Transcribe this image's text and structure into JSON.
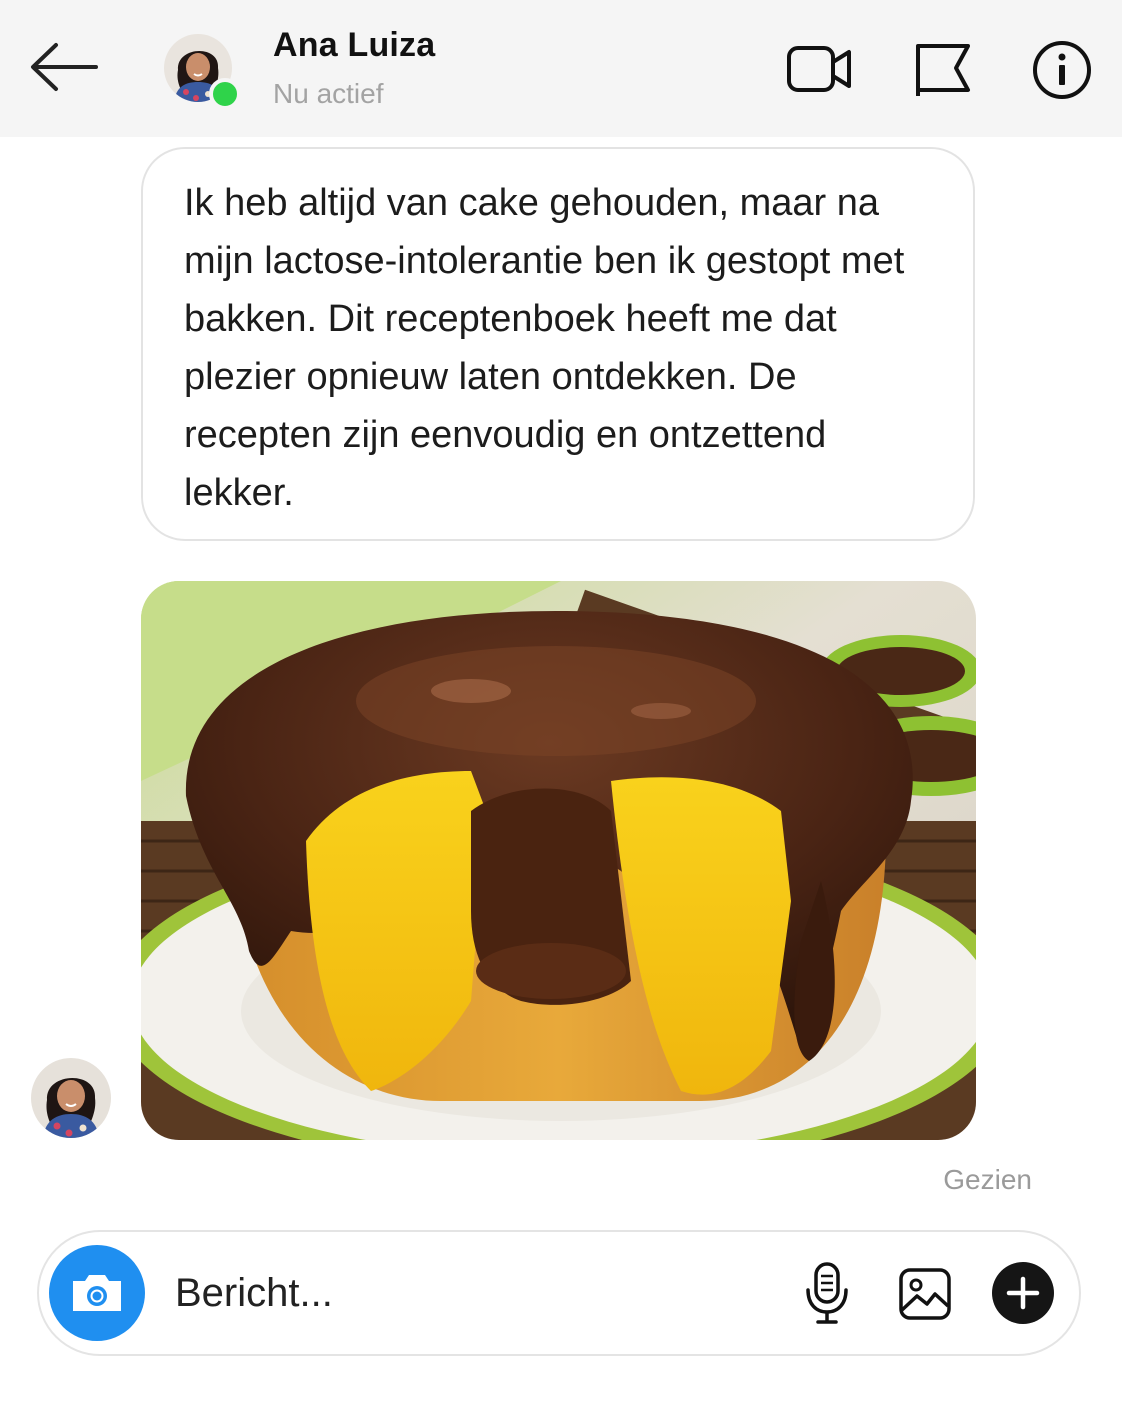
{
  "header": {
    "contact_name": "Ana Luiza",
    "status": "Nu actief",
    "icons": [
      "back-arrow-icon",
      "video-call-icon",
      "flag-icon",
      "info-icon"
    ],
    "online_color": "#2fd34a"
  },
  "messages": [
    {
      "type": "text",
      "text": "Ik heb altijd van cake gehouden, maar na mijn lactose-intolerantie ben ik gestopt met bakken. Dit receptenboek heeft me dat plezier opnieuw laten ontdekken. De recepten zijn eenvoudig en ontzettend lekker."
    },
    {
      "type": "image",
      "image_subject": "cake-with-chocolate-glaze"
    }
  ],
  "seen_label": "Gezien",
  "composer": {
    "placeholder": "Bericht...",
    "camera_color": "#1f8ff0",
    "icons": [
      "camera-icon",
      "microphone-icon",
      "gallery-icon",
      "plus-icon"
    ]
  }
}
